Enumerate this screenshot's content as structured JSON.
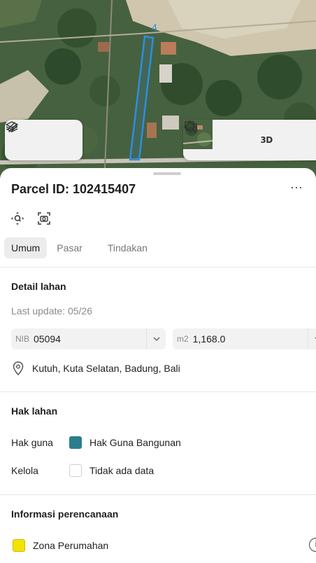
{
  "map": {
    "parcel_number_label": "4",
    "controls_left": [
      {
        "icon": "layers-icon"
      },
      {
        "icon": "draw-icon"
      }
    ],
    "controls_right": [
      {
        "icon": "basemap-thumbnail"
      },
      {
        "icon": "crosshair-icon"
      },
      {
        "label": "3D"
      },
      {
        "icon": "chat-icon"
      }
    ],
    "parcel_color": "#2f8de0"
  },
  "sheet": {
    "title": "Parcel ID: 102415407",
    "more_label": "···",
    "close_label": "×",
    "tabs": [
      {
        "label": "Umum",
        "active": true
      },
      {
        "label": "Pasar",
        "active": false
      },
      {
        "label": "Tindakan",
        "active": false
      }
    ],
    "detail": {
      "title": "Detail lahan",
      "last_update": "Last update: 05/26",
      "nib_prefix": "NIB",
      "nib_value": "05094",
      "area_prefix": "m2",
      "area_value": "1,168.0",
      "location": "Kutuh, Kuta Selatan, Badung, Bali"
    },
    "rights": {
      "title": "Hak lahan",
      "rows": [
        {
          "label": "Hak guna",
          "value": "Hak Guna Bangunan",
          "color": "#2a7e8f"
        },
        {
          "label": "Kelola",
          "value": "Tidak ada data",
          "color": "#ffffff"
        }
      ]
    },
    "planning": {
      "title": "Informasi perencanaan",
      "zone": "Zona Perumahan",
      "zone_color": "#f4e300",
      "info_label": "i"
    }
  }
}
